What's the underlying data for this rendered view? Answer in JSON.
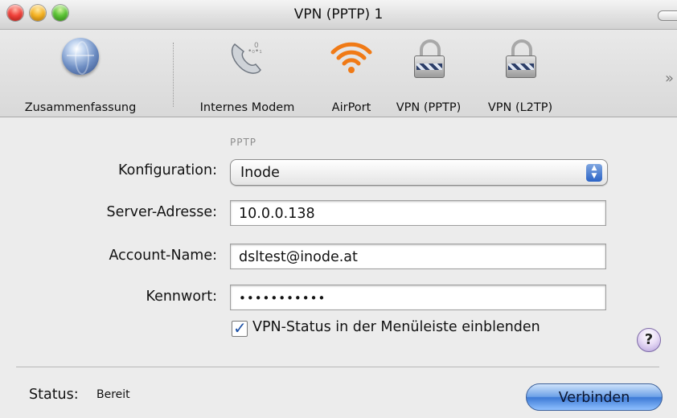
{
  "window": {
    "title": "VPN (PPTP) 1"
  },
  "toolbar": {
    "items": [
      {
        "label": "Zusammenfassung",
        "icon": "globe-icon"
      },
      {
        "label": "Internes Modem",
        "icon": "phone-modem-icon"
      },
      {
        "label": "AirPort",
        "icon": "wifi-icon"
      },
      {
        "label": "VPN (PPTP)",
        "icon": "lock-icon"
      },
      {
        "label": "VPN (L2TP)",
        "icon": "lock-icon"
      }
    ],
    "overflow": "»"
  },
  "form": {
    "section_label": "PPTP",
    "configuration": {
      "label": "Konfiguration:",
      "value": "Inode"
    },
    "server": {
      "label": "Server-Adresse:",
      "value": "10.0.0.138"
    },
    "account": {
      "label": "Account-Name:",
      "value": "dsltest@inode.at"
    },
    "password": {
      "label": "Kennwort:",
      "value": "•••••••••••"
    },
    "show_status": {
      "label": "VPN-Status in der Menüleiste einblenden",
      "checked": true
    }
  },
  "footer": {
    "status_label": "Status:",
    "status_value": "Bereit",
    "connect_button": "Verbinden",
    "help": "?"
  },
  "colors": {
    "accent": "#3d7ad6",
    "wifi": "#f07a16"
  }
}
